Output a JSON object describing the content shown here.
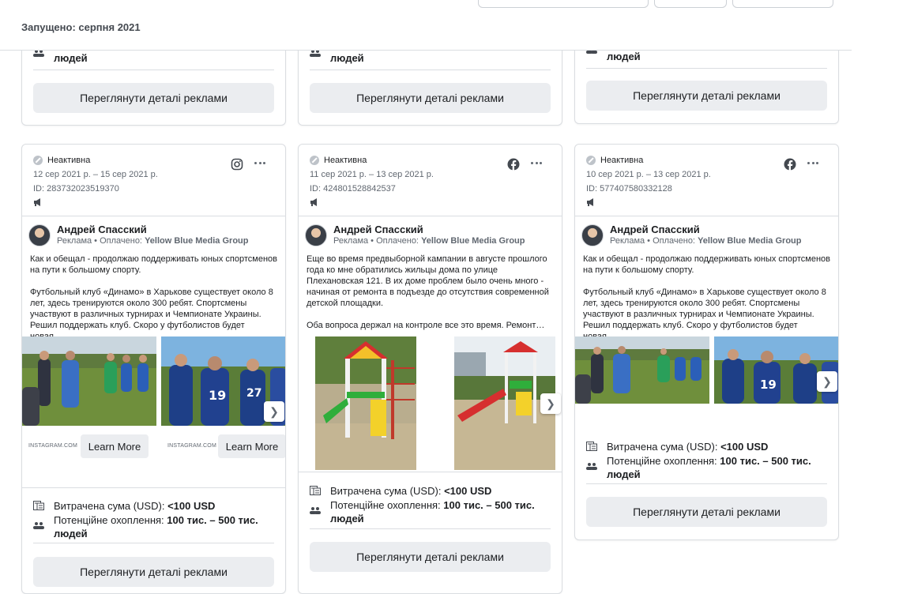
{
  "header": {
    "launched_label": "Запущено: серпня 2021"
  },
  "labels": {
    "details_button": "Переглянути деталі реклами",
    "reach_tail": "людей",
    "status_inactive": "Неактивна",
    "spend_label": "Витрачена сума (USD):",
    "spend_value": "<100 USD",
    "reach_label": "Потенційне охоплення:",
    "reach_value": "100 тис. – 500 тис. людей",
    "sponsored_prefix": "Реклама • Оплачено:",
    "sponsor_name": "Yellow Blue Media Group",
    "author": "Андрей Спасский",
    "learn_more": "Learn More",
    "instagram_domain": "INSTAGRAM.COM"
  },
  "cards": [
    {
      "platform": "instagram-icon",
      "dates": "12 сер 2021 р. – 15 сер 2021 р.",
      "id": "ID: 283732023519370",
      "text_p1": "Как и обещал - продолжаю поддерживать юных спортсменов на пути к большому спорту.",
      "text_p2": "Футбольный клуб «Динамо» в Харькове существует около 8 лет, здесь тренируются около 300 ребят. Спортсмены участвуют в различных турнирах и Чемпионате Украины. Решил поддержать клуб. Скоро у футболистов будет новая…"
    },
    {
      "platform": "facebook-icon",
      "dates": "11 сер 2021 р. – 13 сер 2021 р.",
      "id": "ID: 424801528842537",
      "text_p1": "Еще во время предвыборной кампании в августе прошлого года ко мне обратились жильцы дома по улице Плехановская 121. В их доме проблем было очень много - начиная от ремонта в подъезде до отсутствия современной детской площадки.",
      "text_p2": "Оба вопроса держал на контроле все это время. Ремонт…"
    },
    {
      "platform": "facebook-icon",
      "dates": "10 сер 2021 р. – 13 сер 2021 р.",
      "id": "ID: 577407580332128",
      "text_p1": "Как и обещал - продолжаю поддерживать юных спортсменов на пути к большому спорту.",
      "text_p2": "Футбольный клуб «Динамо» в Харькове существует около 8 лет, здесь тренируются около 300 ребят. Спортсмены участвуют в различных турнирах и Чемпионате Украины. Решил поддержать клуб. Скоро у футболистов будет новая…"
    }
  ]
}
